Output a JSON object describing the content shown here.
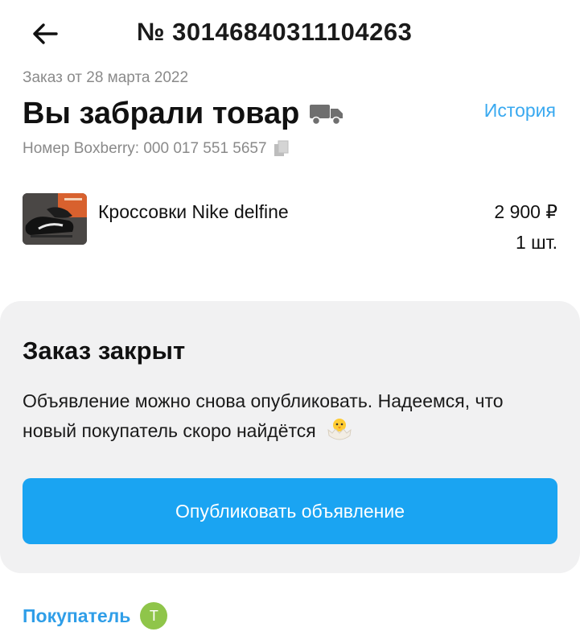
{
  "header": {
    "order_number": "№ 30146840311104263"
  },
  "order": {
    "date_text": "Заказ от 28 марта 2022",
    "status_title": "Вы забрали товар",
    "history_link": "История",
    "tracking_text": "Номер Boxberry: 000 017 551 5657"
  },
  "product": {
    "name": "Кроссовки Nike delfine",
    "price": "2 900 ₽",
    "quantity": "1 шт."
  },
  "closed_card": {
    "title": "Заказ закрыт",
    "message": "Объявление можно снова опубликовать. Надеемся, что новый покупатель скоро найдётся",
    "button_label": "Опубликовать объявление"
  },
  "buyer": {
    "label": "Покупатель",
    "avatar_initial": "Т"
  },
  "colors": {
    "accent": "#1aa4f2",
    "link": "#39a9f0",
    "card_bg": "#f1f1f2",
    "secondary_text": "#8a8a8a",
    "avatar_bg": "#8fc54a"
  },
  "icons": [
    "back-arrow-icon",
    "truck-icon",
    "copy-icon",
    "hatching-chick-emoji"
  ]
}
